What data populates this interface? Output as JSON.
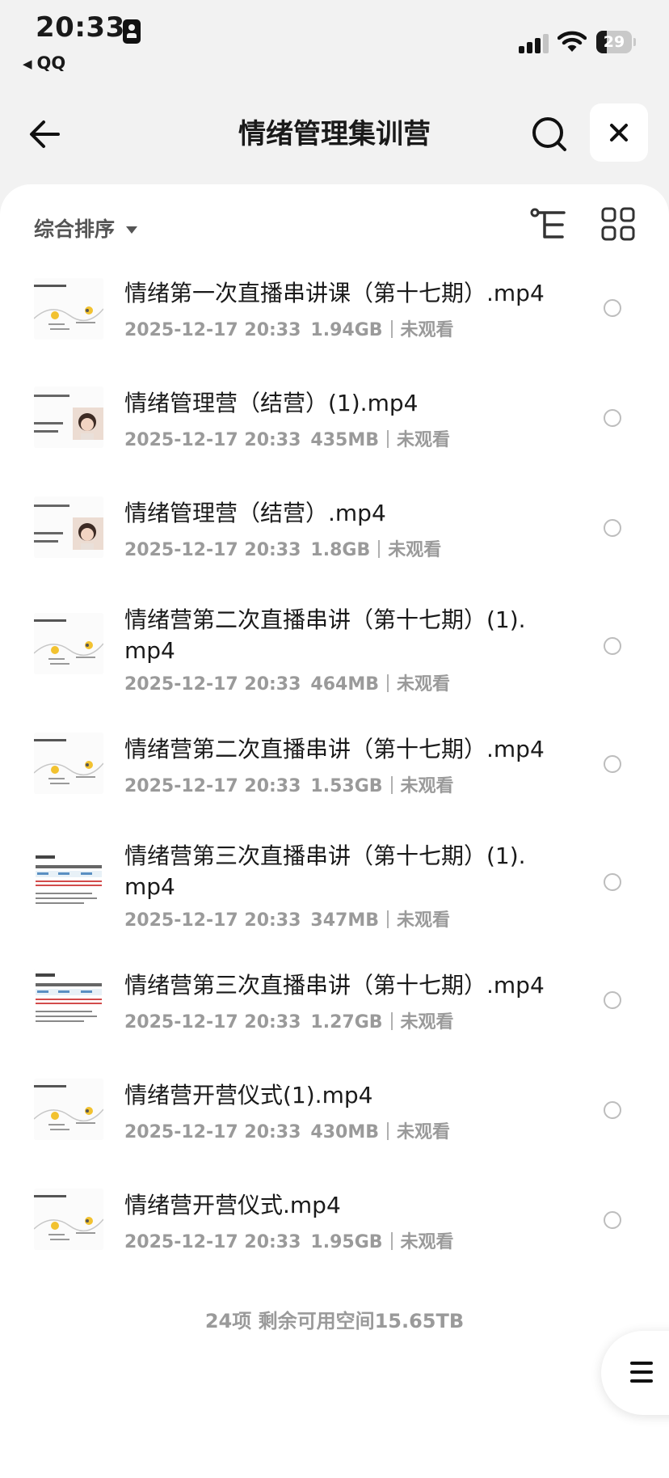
{
  "status_bar": {
    "time": "20:33",
    "back_app": "QQ",
    "battery": "29",
    "battery_level": 0.29
  },
  "nav": {
    "title": "情绪管理集训营"
  },
  "toolbar": {
    "sort_label": "综合排序"
  },
  "files": [
    {
      "name": "情绪第一次直播串讲课（第十七期）.mp4",
      "date": "2025-12-17 20:33",
      "size": "1.94GB",
      "status": "未观看",
      "thumb": "mindmap"
    },
    {
      "name": "情绪管理营（结营）(1).mp4",
      "date": "2025-12-17 20:33",
      "size": "435MB",
      "status": "未观看",
      "thumb": "person"
    },
    {
      "name": "情绪管理营（结营）.mp4",
      "date": "2025-12-17 20:33",
      "size": "1.8GB",
      "status": "未观看",
      "thumb": "person"
    },
    {
      "name": "情绪营第二次直播串讲（第十七期）(1).mp4",
      "date": "2025-12-17 20:33",
      "size": "464MB",
      "status": "未观看",
      "thumb": "mindmap"
    },
    {
      "name": "情绪营第二次直播串讲（第十七期）.mp4",
      "date": "2025-12-17 20:33",
      "size": "1.53GB",
      "status": "未观看",
      "thumb": "mindmap"
    },
    {
      "name": "情绪营第三次直播串讲（第十七期）(1).mp4",
      "date": "2025-12-17 20:33",
      "size": "347MB",
      "status": "未观看",
      "thumb": "table"
    },
    {
      "name": "情绪营第三次直播串讲（第十七期）.mp4",
      "date": "2025-12-17 20:33",
      "size": "1.27GB",
      "status": "未观看",
      "thumb": "table"
    },
    {
      "name": "情绪营开营仪式(1).mp4",
      "date": "2025-12-17 20:33",
      "size": "430MB",
      "status": "未观看",
      "thumb": "mindmap"
    },
    {
      "name": "情绪营开营仪式.mp4",
      "date": "2025-12-17 20:33",
      "size": "1.95GB",
      "status": "未观看",
      "thumb": "mindmap"
    }
  ],
  "footer": {
    "summary": "24项 剩余可用空间15.65TB"
  }
}
